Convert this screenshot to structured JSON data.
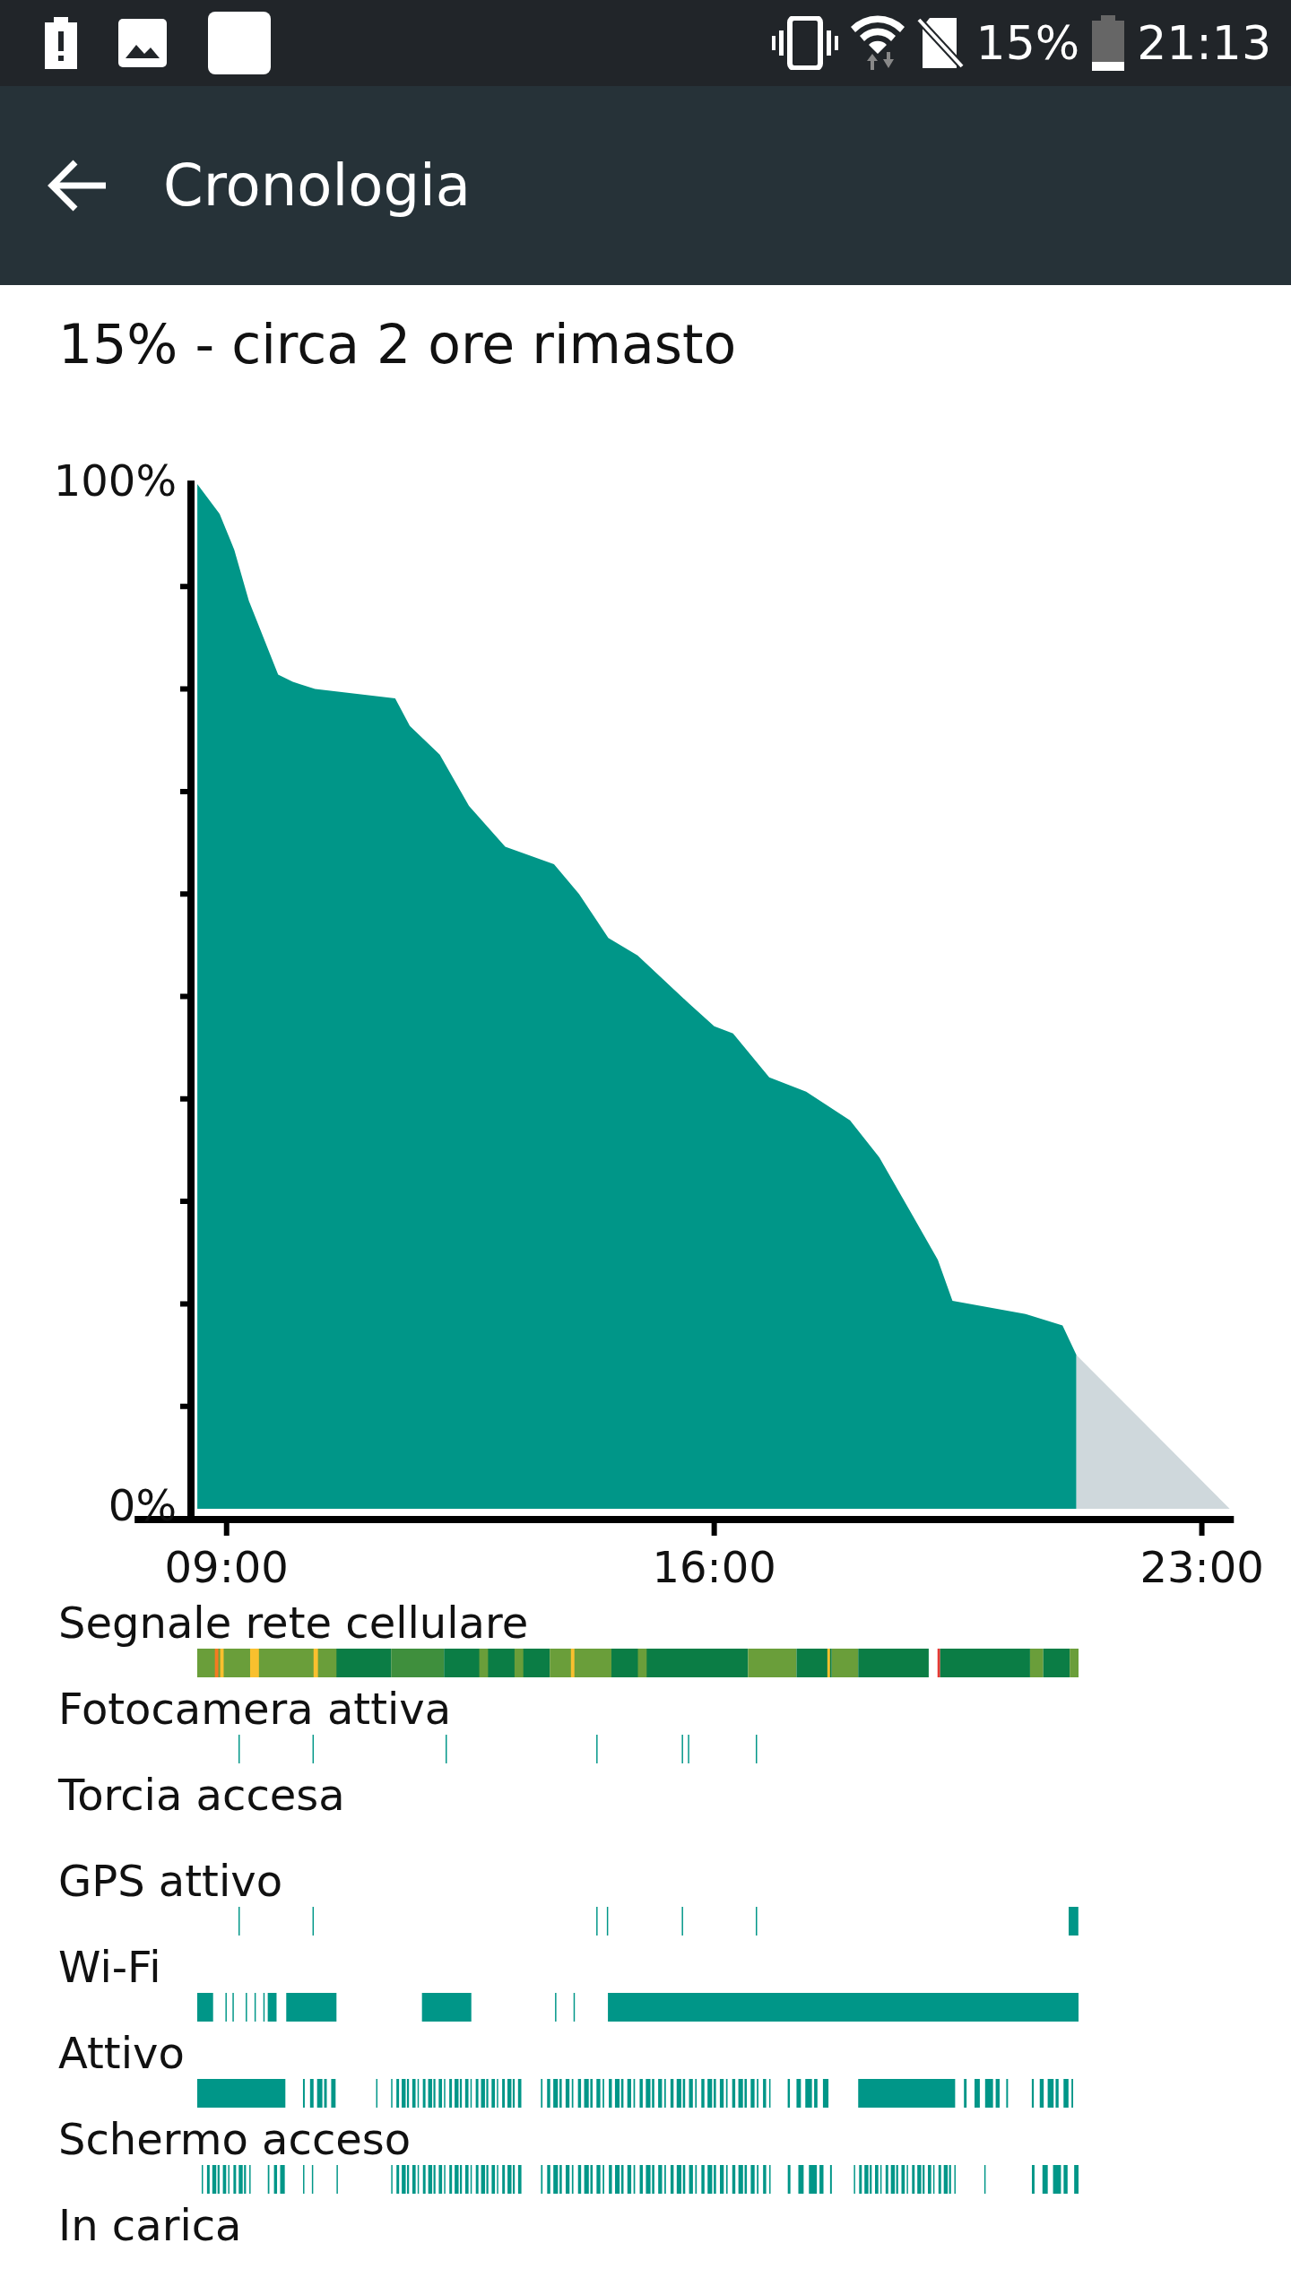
{
  "status_bar": {
    "battery_text": "15%",
    "time": "21:13"
  },
  "toolbar": {
    "title": "Cronologia"
  },
  "summary": "15% - circa 2 ore rimasto",
  "chart_data": {
    "type": "area",
    "x": [
      8.58,
      8.9,
      9.11,
      9.32,
      9.49,
      9.74,
      9.95,
      10.27,
      11.42,
      11.63,
      12.06,
      12.48,
      13.0,
      13.7,
      14.06,
      14.48,
      14.9,
      15.64,
      16.0,
      16.27,
      16.79,
      17.32,
      17.95,
      18.37,
      18.79,
      19.21,
      19.42,
      20.47,
      21.0,
      21.2,
      23.4
    ],
    "series": [
      {
        "color": "#009688",
        "values": [
          100,
          97.1,
          93.6,
          88.6,
          85.7,
          81.4,
          80.7,
          80,
          79.1,
          76.4,
          73.6,
          68.6,
          64.6,
          62.9,
          60,
          55.7,
          54,
          49.3,
          47.1,
          46.4,
          42.1,
          40.7,
          37.9,
          34.3,
          29.3,
          24.3,
          20.3,
          19,
          17.9,
          15,
          null
        ]
      },
      {
        "color": "#cfd8dc",
        "values": [
          null,
          null,
          null,
          null,
          null,
          null,
          null,
          null,
          null,
          null,
          null,
          null,
          null,
          null,
          null,
          null,
          null,
          null,
          null,
          null,
          null,
          null,
          null,
          null,
          null,
          null,
          null,
          null,
          null,
          15,
          0
        ]
      }
    ],
    "xlim": [
      7.68,
      23.46
    ],
    "ylim": [
      0,
      100
    ],
    "xticks": [
      {
        "value": 9,
        "label": "09:00"
      },
      {
        "value": 16,
        "label": "16:00"
      },
      {
        "value": 23,
        "label": "23:00"
      }
    ],
    "yticks": [
      {
        "value": 0,
        "label": "0%"
      },
      {
        "value": 100,
        "label": "100%"
      }
    ]
  },
  "events": [
    {
      "label": "Segnale rete cellulare",
      "kind": "signal"
    },
    {
      "label": "Fotocamera attiva",
      "kind": "events"
    },
    {
      "label": "Torcia accesa",
      "kind": "events"
    },
    {
      "label": "GPS attivo",
      "kind": "events"
    },
    {
      "label": "Wi-Fi",
      "kind": "events"
    },
    {
      "label": "Attivo",
      "kind": "events"
    },
    {
      "label": "Schermo acceso",
      "kind": "events"
    },
    {
      "label": "In carica",
      "kind": "events"
    }
  ]
}
